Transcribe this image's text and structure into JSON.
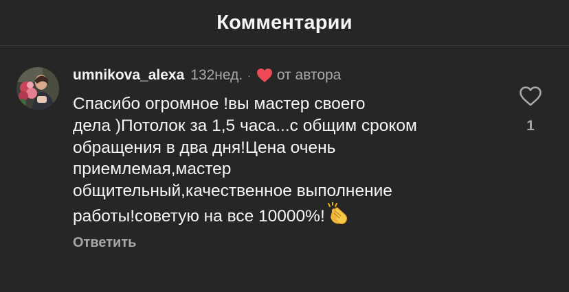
{
  "header": {
    "title": "Комментарии"
  },
  "comment": {
    "username": "umnikova_alexa",
    "time": "132нед.",
    "separator": "·",
    "author_label": "от автора",
    "text": "Спасибо огромное !вы мастер своего\nдела )Потолок за 1,5 часа...с общим сроком\nобращения в два дня!Цена очень\nприемлемая,мастер\nобщительный,качественное выполнение\nработы!советую на все 10000%!",
    "reply_label": "Ответить",
    "like_count": "1"
  },
  "icons": {
    "author_like": "heart-filled-icon",
    "emoji": "clapping-hands-icon",
    "like": "heart-outline-icon"
  },
  "colors": {
    "background": "#262626",
    "text": "#f5f5f5",
    "secondary": "#a8a8a8",
    "heart": "#ed4956"
  }
}
